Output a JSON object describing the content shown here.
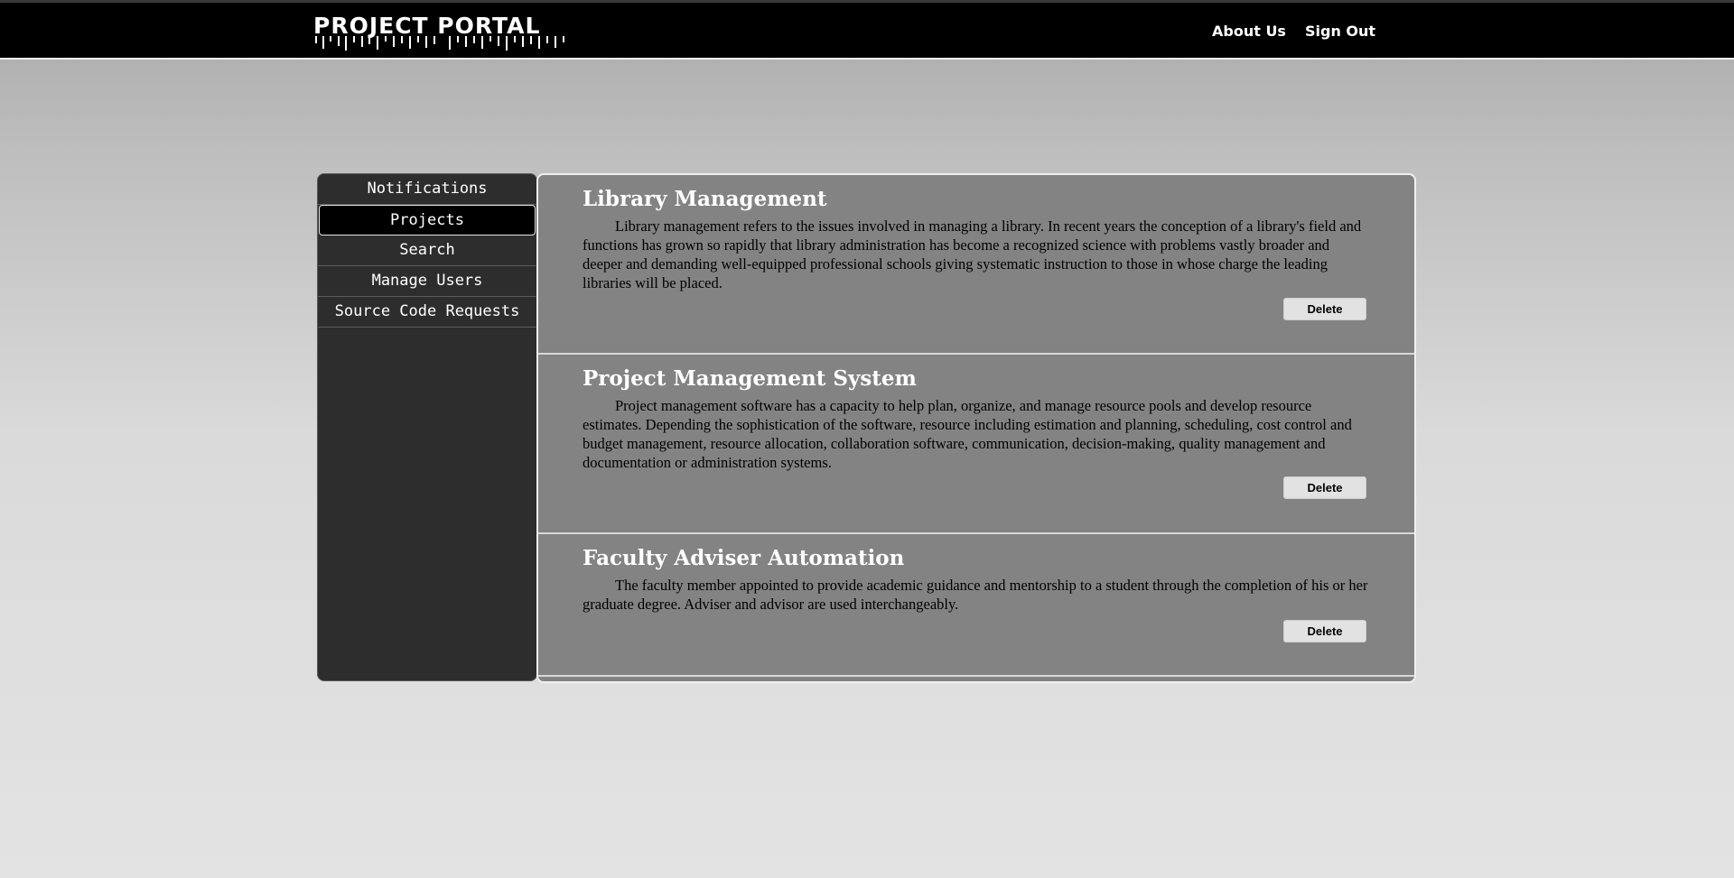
{
  "header": {
    "logo_text": "PROJECT PORTAL",
    "nav": [
      {
        "label": "About Us"
      },
      {
        "label": "Sign Out"
      }
    ]
  },
  "sidebar": {
    "items": [
      {
        "label": "Notifications",
        "active": false
      },
      {
        "label": "Projects",
        "active": true
      },
      {
        "label": "Search",
        "active": false
      },
      {
        "label": "Manage Users",
        "active": false
      },
      {
        "label": "Source Code Requests",
        "active": false
      }
    ]
  },
  "projects": [
    {
      "title": "Library Management",
      "description": "Library management refers to the issues involved in managing a library. In recent years the conception of a library's field and functions has grown so rapidly that library administration has become a recognized science with problems vastly broader and deeper and demanding well-equipped professional schools giving systematic instruction to those in whose charge the leading libraries will be placed.",
      "delete_label": "Delete"
    },
    {
      "title": "Project Management System",
      "description": "Project management software has a capacity to help plan, organize, and manage resource pools and develop resource estimates. Depending the sophistication of the software, resource including estimation and planning, scheduling, cost control and budget management, resource allocation, collaboration software, communication, decision-making, quality management and documentation or administration systems.",
      "delete_label": "Delete"
    },
    {
      "title": "Faculty Adviser Automation",
      "description": "The faculty member appointed to provide academic guidance and mentorship to a student through the completion of his or her graduate degree. Adviser and advisor are used interchangeably.",
      "delete_label": "Delete"
    }
  ],
  "colors": {
    "header_bg": "#000000",
    "sidebar_bg": "#2d2d2d",
    "content_bg": "#838383",
    "button_bg": "#e2e2e2"
  }
}
